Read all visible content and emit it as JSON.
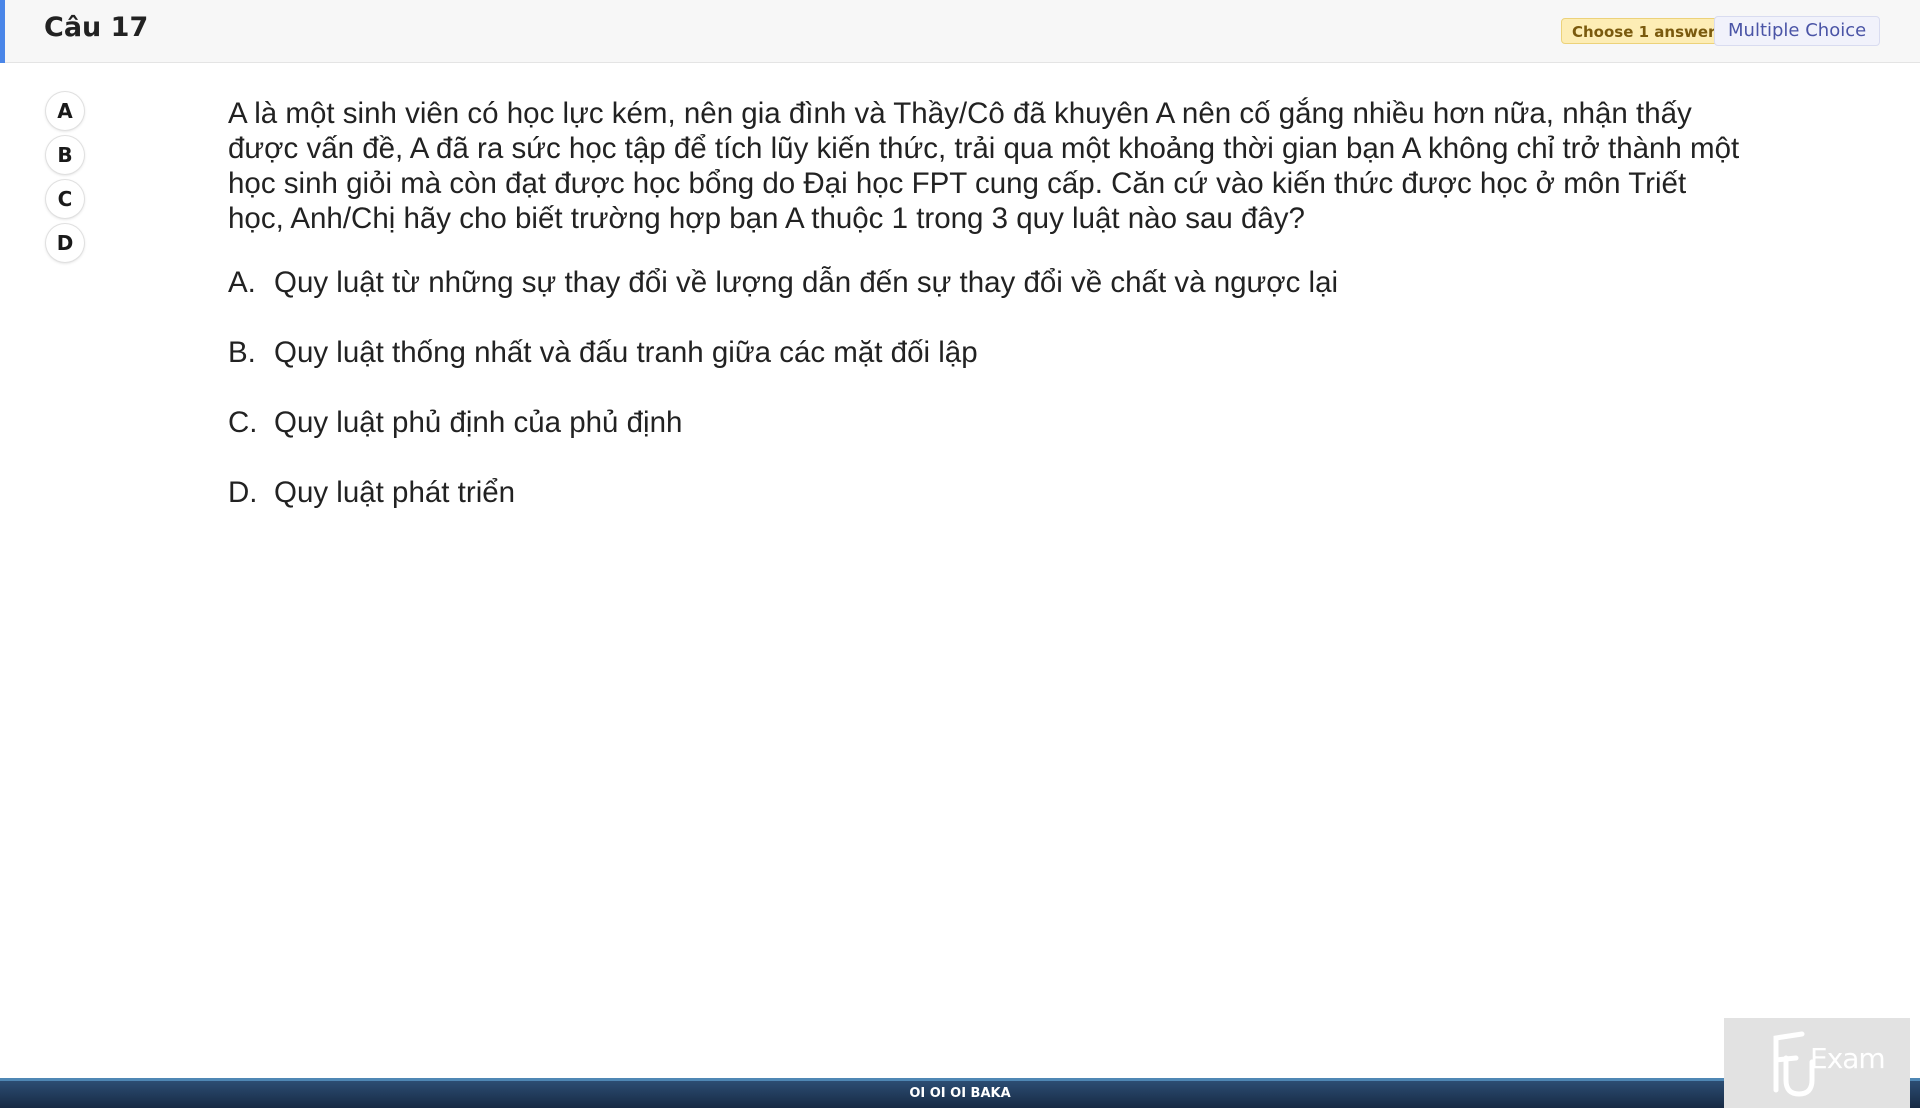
{
  "header": {
    "question_number": "Câu 17",
    "choose_badge": "Choose 1 answer",
    "type_badge": "Multiple Choice"
  },
  "answer_buttons": [
    "A",
    "B",
    "C",
    "D"
  ],
  "question": {
    "text": "A là một sinh viên có học lực kém, nên gia đình và Thầy/Cô đã khuyên A nên cố gắng nhiều hơn nữa, nhận thấy được vấn đề, A đã ra sức học tập để tích lũy kiến thức, trải qua một khoảng thời gian bạn A không chỉ trở thành một học sinh giỏi mà còn đạt được học bổng do Đại học FPT cung cấp. Căn cứ vào kiến thức được học ở môn Triết học, Anh/Chị hãy cho biết trường hợp bạn A thuộc 1 trong 3 quy luật nào sau đây?",
    "options": [
      {
        "letter": "A.",
        "text": "Quy luật từ những sự thay đổi về lượng dẫn đến sự thay đổi về chất và ngược lại"
      },
      {
        "letter": "B.",
        "text": "Quy luật thống nhất và đấu tranh giữa các mặt đối lập"
      },
      {
        "letter": "C.",
        "text": "Quy luật phủ định của phủ định"
      },
      {
        "letter": "D.",
        "text": "Quy luật phát triển"
      }
    ]
  },
  "footer": {
    "text": "OI OI OI BAKA"
  },
  "logo": {
    "text": "Exam",
    "icon": "fu-exam-logo-icon"
  }
}
